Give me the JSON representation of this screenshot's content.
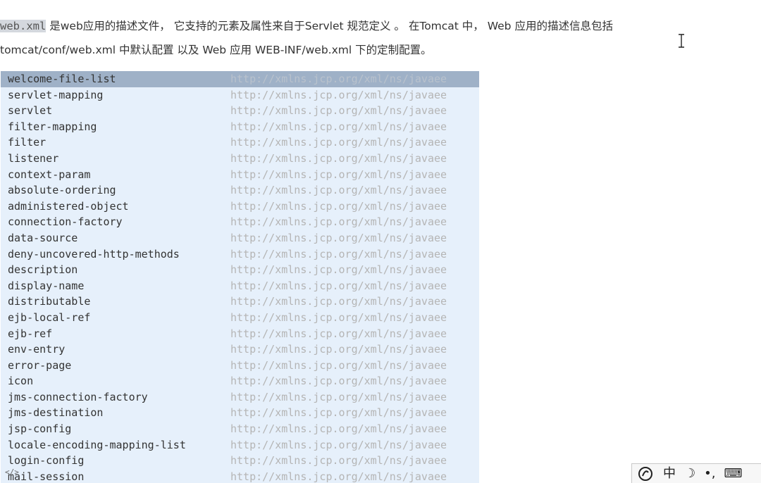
{
  "paragraph": {
    "line1_code": "web.xml",
    "line1_text_a": " 是web应用的描述文件， 它支持的元素及属性来自于Servlet 规范定义 。 在Tomcat 中， Web 应用的描述信息包括",
    "line2_text": "tomcat/conf/web.xml 中默认配置 以及 Web 应用 WEB-INF/web.xml 下的定制配置。"
  },
  "autocomplete": {
    "selected_index": 0,
    "items": [
      {
        "name": "welcome-file-list",
        "ns": "http://xmlns.jcp.org/xml/ns/javaee"
      },
      {
        "name": "servlet-mapping",
        "ns": "http://xmlns.jcp.org/xml/ns/javaee"
      },
      {
        "name": "servlet",
        "ns": "http://xmlns.jcp.org/xml/ns/javaee"
      },
      {
        "name": "filter-mapping",
        "ns": "http://xmlns.jcp.org/xml/ns/javaee"
      },
      {
        "name": "filter",
        "ns": "http://xmlns.jcp.org/xml/ns/javaee"
      },
      {
        "name": "listener",
        "ns": "http://xmlns.jcp.org/xml/ns/javaee"
      },
      {
        "name": "context-param",
        "ns": "http://xmlns.jcp.org/xml/ns/javaee"
      },
      {
        "name": "absolute-ordering",
        "ns": "http://xmlns.jcp.org/xml/ns/javaee"
      },
      {
        "name": "administered-object",
        "ns": "http://xmlns.jcp.org/xml/ns/javaee"
      },
      {
        "name": "connection-factory",
        "ns": "http://xmlns.jcp.org/xml/ns/javaee"
      },
      {
        "name": "data-source",
        "ns": "http://xmlns.jcp.org/xml/ns/javaee"
      },
      {
        "name": "deny-uncovered-http-methods",
        "ns": "http://xmlns.jcp.org/xml/ns/javaee"
      },
      {
        "name": "description",
        "ns": "http://xmlns.jcp.org/xml/ns/javaee"
      },
      {
        "name": "display-name",
        "ns": "http://xmlns.jcp.org/xml/ns/javaee"
      },
      {
        "name": "distributable",
        "ns": "http://xmlns.jcp.org/xml/ns/javaee"
      },
      {
        "name": "ejb-local-ref",
        "ns": "http://xmlns.jcp.org/xml/ns/javaee"
      },
      {
        "name": "ejb-ref",
        "ns": "http://xmlns.jcp.org/xml/ns/javaee"
      },
      {
        "name": "env-entry",
        "ns": "http://xmlns.jcp.org/xml/ns/javaee"
      },
      {
        "name": "error-page",
        "ns": "http://xmlns.jcp.org/xml/ns/javaee"
      },
      {
        "name": "icon",
        "ns": "http://xmlns.jcp.org/xml/ns/javaee"
      },
      {
        "name": "jms-connection-factory",
        "ns": "http://xmlns.jcp.org/xml/ns/javaee"
      },
      {
        "name": "jms-destination",
        "ns": "http://xmlns.jcp.org/xml/ns/javaee"
      },
      {
        "name": "jsp-config",
        "ns": "http://xmlns.jcp.org/xml/ns/javaee"
      },
      {
        "name": "locale-encoding-mapping-list",
        "ns": "http://xmlns.jcp.org/xml/ns/javaee"
      },
      {
        "name": "login-config",
        "ns": "http://xmlns.jcp.org/xml/ns/javaee"
      },
      {
        "name": "mail-session",
        "ns": "http://xmlns.jcp.org/xml/ns/javaee"
      }
    ]
  },
  "footer": {
    "tag_icon_glyph": "</>"
  },
  "ime": {
    "logo_icon": "sogou-logo-icon",
    "lang_label": "中",
    "moon_glyph": "☽",
    "punct_glyph": "•,",
    "keyboard_glyph": "⌨"
  },
  "colors": {
    "popup_bg": "#e6f0fb",
    "selected_bg": "#9fb1c7",
    "namespace_text": "#b5b5b5"
  }
}
